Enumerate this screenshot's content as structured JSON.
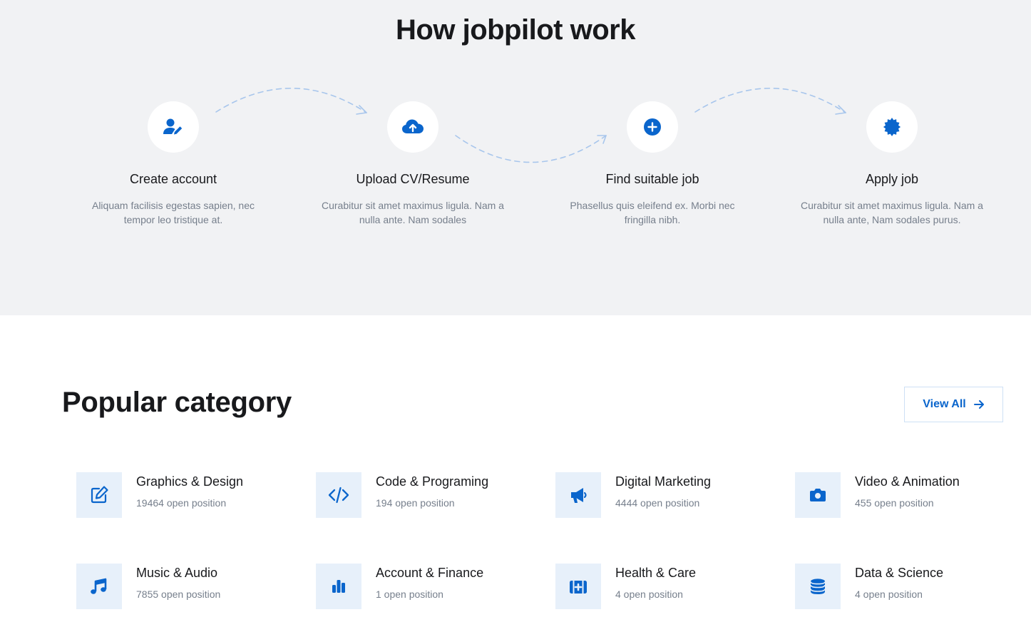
{
  "how_it_works": {
    "title": "How jobpilot work",
    "steps": [
      {
        "icon": "user-edit-icon",
        "title": "Create account",
        "desc": "Aliquam facilisis egestas sapien, nec tempor leo tristique at."
      },
      {
        "icon": "cloud-upload-icon",
        "title": "Upload CV/Resume",
        "desc": "Curabitur sit amet maximus ligula. Nam a nulla ante. Nam sodales"
      },
      {
        "icon": "plus-circle-icon",
        "title": "Find suitable job",
        "desc": "Phasellus quis eleifend ex. Morbi nec fringilla nibh."
      },
      {
        "icon": "badge-check-icon",
        "title": "Apply job",
        "desc": "Curabitur sit amet maximus ligula. Nam a nulla ante, Nam sodales purus."
      }
    ]
  },
  "popular": {
    "title": "Popular category",
    "view_all_label": "View All",
    "categories": [
      {
        "icon": "pen-square-icon",
        "name": "Graphics & Design",
        "count": "19464 open position"
      },
      {
        "icon": "code-icon",
        "name": "Code & Programing",
        "count": "194 open position"
      },
      {
        "icon": "megaphone-icon",
        "name": "Digital Marketing",
        "count": "4444 open position"
      },
      {
        "icon": "camera-icon",
        "name": "Video & Animation",
        "count": "455 open position"
      },
      {
        "icon": "music-note-icon",
        "name": "Music & Audio",
        "count": "7855 open position"
      },
      {
        "icon": "bar-chart-icon",
        "name": "Account & Finance",
        "count": "1 open position"
      },
      {
        "icon": "first-aid-kit-icon",
        "name": "Health & Care",
        "count": "4 open position"
      },
      {
        "icon": "database-icon",
        "name": "Data & Science",
        "count": "4 open position"
      }
    ]
  },
  "colors": {
    "primary": "#0a65cc",
    "icon_bg": "#e7f0fa",
    "section_bg": "#f1f2f4",
    "text_dark": "#18191c",
    "text_muted": "#767f8c"
  }
}
